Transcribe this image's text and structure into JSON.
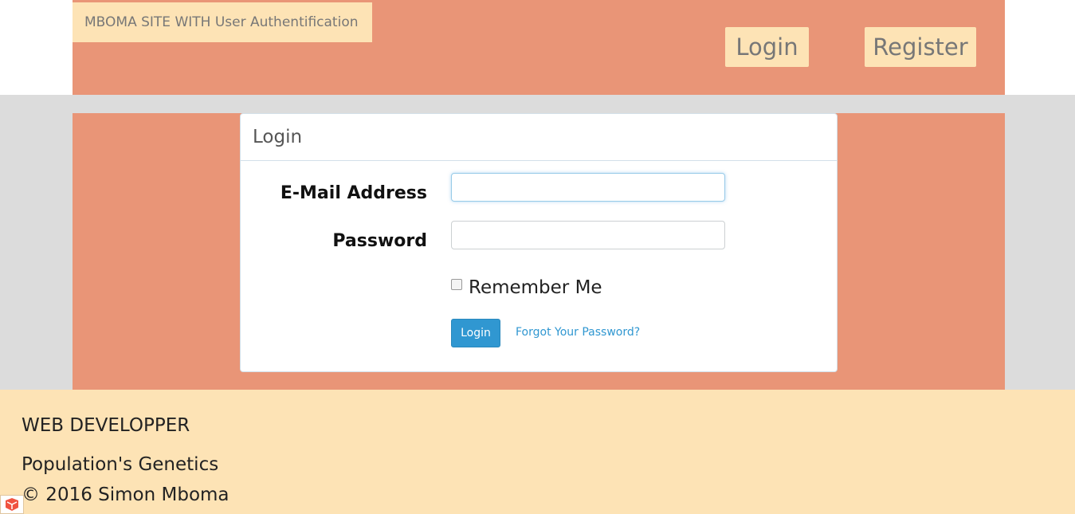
{
  "header": {
    "brand": "MBOMA SITE WITH User Authentification",
    "nav": {
      "login": "Login",
      "register": "Register"
    }
  },
  "panel": {
    "title": "Login",
    "email_label": "E-Mail Address",
    "email_value": "",
    "password_label": "Password",
    "password_value": "",
    "remember_label": "Remember Me",
    "remember_checked": false,
    "submit_label": "Login",
    "forgot_link": "Forgot Your Password?"
  },
  "footer": {
    "line1": "WEB DEVELOPPER",
    "line2": "Population's Genetics",
    "line3": "© 2016 Simon Mboma"
  },
  "colors": {
    "header_bg": "#e99577",
    "accent_cream": "#fde3b5",
    "primary_button": "#3097d1",
    "grey_band": "#dcdcdc"
  },
  "icons": {
    "corner": "laravel-logo-icon"
  }
}
